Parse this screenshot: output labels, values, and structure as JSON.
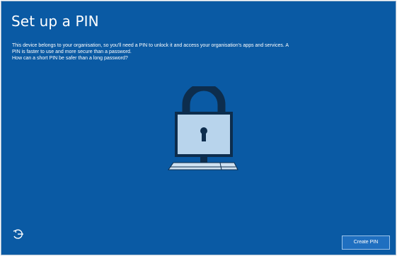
{
  "page": {
    "title": "Set up a PIN",
    "description": "This device belongs to your organisation, so you'll need a PIN to unlock it and access your organisation's apps and services. A PIN is faster to use and more secure than a password.",
    "link_text": "How can a short PIN be safer than a long password?"
  },
  "footer": {
    "accessibility_icon": "ease-of-access-icon",
    "create_pin_label": "Create PIN"
  },
  "illustration": {
    "icon": "padlock-laptop-icon"
  },
  "colors": {
    "background": "#0a5aa4",
    "lock_shackle": "#0d2d4d",
    "lock_body": "#b8d4ec",
    "keyhole": "#0d2d4d",
    "button": "#1f6fc0",
    "text": "#ffffff"
  }
}
